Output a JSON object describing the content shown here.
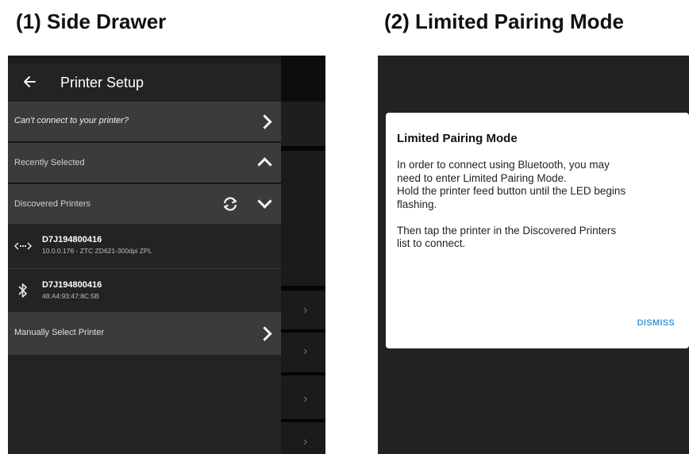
{
  "captions": {
    "side_drawer": "(1) Side Drawer",
    "limited_pairing": "(2) Limited Pairing Mode"
  },
  "drawer": {
    "title": "Printer Setup",
    "cant_connect": "Can't connect to your printer?",
    "recently_selected": "Recently Selected",
    "discovered_printers": "Discovered Printers",
    "printers": [
      {
        "name": "D7J194800416",
        "detail": "10.0.0.176 - ZTC ZD621-300dpi ZPL",
        "icon": "network-icon"
      },
      {
        "name": "D7J194800416",
        "detail": "48:A4:93:47:8C:5B",
        "icon": "bluetooth-icon"
      }
    ],
    "manual_select": "Manually Select Printer"
  },
  "dialog": {
    "title": "Limited Pairing Mode",
    "para1_line1": "In order to connect using Bluetooth, you may",
    "para1_line2": "need to enter Limited Pairing Mode.",
    "para1_line3": "Hold the printer feed button until the LED begins",
    "para1_line4": "flashing.",
    "para2_line1": "Then tap the printer in the Discovered Printers",
    "para2_line2": "list to connect.",
    "dismiss": "DISMISS"
  },
  "colors": {
    "accent": "#3f9fd6",
    "drawer_bg": "#232323",
    "row_light": "#3b3b3b",
    "dialog_bg": "#ffffff",
    "screen_bg": "#222222"
  }
}
